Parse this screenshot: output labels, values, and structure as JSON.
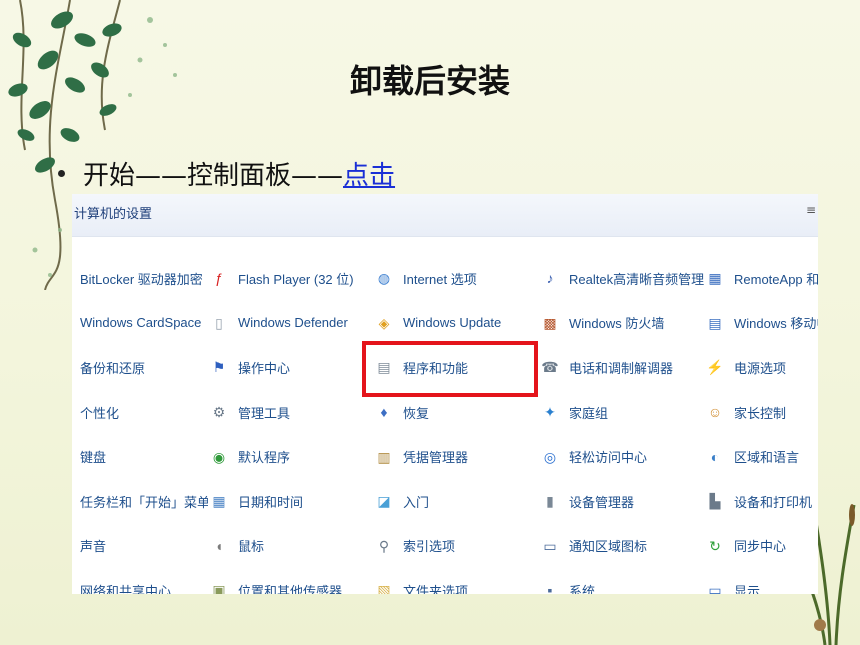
{
  "slide": {
    "title": "卸载后安装",
    "bullet_text": "开始——控制面板——",
    "bullet_link": "点击"
  },
  "panel": {
    "title": "计算机的设置",
    "side_text": "≡",
    "columns": [
      [
        {
          "label": "BitLocker 驱动器加密"
        },
        {
          "label": "Windows CardSpace"
        },
        {
          "label": "备份和还原"
        },
        {
          "label": "个性化"
        },
        {
          "label": "键盘"
        },
        {
          "label": "任务栏和「开始」菜单"
        },
        {
          "label": "声音"
        },
        {
          "label": "网络和共享中心"
        }
      ],
      [
        {
          "label": "Flash Player (32 位)",
          "icon": "flash-icon",
          "glyph": "ƒ",
          "color": "#d71f1f"
        },
        {
          "label": "Windows Defender",
          "icon": "document-icon",
          "glyph": "▯",
          "color": "#9aa5b1"
        },
        {
          "label": "操作中心",
          "icon": "flag-icon",
          "glyph": "⚑",
          "color": "#2e5fbf"
        },
        {
          "label": "管理工具",
          "icon": "tools-icon",
          "glyph": "⚙",
          "color": "#6b7a8a"
        },
        {
          "label": "默认程序",
          "icon": "globe-icon",
          "glyph": "◉",
          "color": "#2f9a3a"
        },
        {
          "label": "日期和时间",
          "icon": "calendar-icon",
          "glyph": "▦",
          "color": "#4f86c6"
        },
        {
          "label": "鼠标",
          "icon": "mouse-icon",
          "glyph": "◖",
          "color": "#7b7b7b"
        },
        {
          "label": "位置和其他传感器",
          "icon": "sensor-icon",
          "glyph": "▣",
          "color": "#8a9b5c"
        }
      ],
      [
        {
          "label": "Internet 选项",
          "icon": "internet-icon",
          "glyph": "◍",
          "color": "#3c7fd0"
        },
        {
          "label": "Windows Update",
          "icon": "update-icon",
          "glyph": "◈",
          "color": "#e0a020"
        },
        {
          "label": "程序和功能",
          "icon": "programs-icon",
          "glyph": "▤",
          "color": "#7f8c99"
        },
        {
          "label": "恢复",
          "icon": "recovery-icon",
          "glyph": "♦",
          "color": "#3d6fc4"
        },
        {
          "label": "凭据管理器",
          "icon": "credential-icon",
          "glyph": "▥",
          "color": "#b08a3e"
        },
        {
          "label": "入门",
          "icon": "getting-started-icon",
          "glyph": "◪",
          "color": "#4aa0d6"
        },
        {
          "label": "索引选项",
          "icon": "search-index-icon",
          "glyph": "⚲",
          "color": "#6b7a8a"
        },
        {
          "label": "文件夹选项",
          "icon": "folder-options-icon",
          "glyph": "▧",
          "color": "#d8b24a"
        }
      ],
      [
        {
          "label": "Realtek高清晰音频管理器",
          "icon": "audio-icon",
          "glyph": "♪",
          "color": "#3a5fb0"
        },
        {
          "label": "Windows 防火墙",
          "icon": "firewall-icon",
          "glyph": "▩",
          "color": "#b5542a"
        },
        {
          "label": "电话和调制解调器",
          "icon": "phone-icon",
          "glyph": "☎",
          "color": "#6b7a8a"
        },
        {
          "label": "家庭组",
          "icon": "homegroup-icon",
          "glyph": "✦",
          "color": "#2a80cf"
        },
        {
          "label": "轻松访问中心",
          "icon": "accessibility-icon",
          "glyph": "◎",
          "color": "#2a6fd0"
        },
        {
          "label": "设备管理器",
          "icon": "device-manager-icon",
          "glyph": "▮",
          "color": "#7a8896"
        },
        {
          "label": "通知区域图标",
          "icon": "notification-icon",
          "glyph": "▭",
          "color": "#4a6a9a"
        },
        {
          "label": "系统",
          "icon": "system-icon",
          "glyph": "▪",
          "color": "#4a6a9a"
        }
      ],
      [
        {
          "label": "RemoteApp 和桌",
          "icon": "remoteapp-icon",
          "glyph": "▦",
          "color": "#3c6fc0"
        },
        {
          "label": "Windows 移动中",
          "icon": "mobility-icon",
          "glyph": "▤",
          "color": "#3c6fc0"
        },
        {
          "label": "电源选项",
          "icon": "power-icon",
          "glyph": "⚡",
          "color": "#3a9a3a"
        },
        {
          "label": "家长控制",
          "icon": "parental-icon",
          "glyph": "☺",
          "color": "#d08a2a"
        },
        {
          "label": "区域和语言",
          "icon": "region-icon",
          "glyph": "◐",
          "color": "#3a7fc8"
        },
        {
          "label": "设备和打印机",
          "icon": "printer-icon",
          "glyph": "▙",
          "color": "#6b7a8a"
        },
        {
          "label": "同步中心",
          "icon": "sync-icon",
          "glyph": "↻",
          "color": "#2fa03a"
        },
        {
          "label": "显示",
          "icon": "display-icon",
          "glyph": "▭",
          "color": "#3a6fc0"
        }
      ]
    ]
  },
  "colors": {
    "highlight": "#e4141b",
    "link": "#1a2fd6",
    "item_text": "#1e4f8c"
  }
}
